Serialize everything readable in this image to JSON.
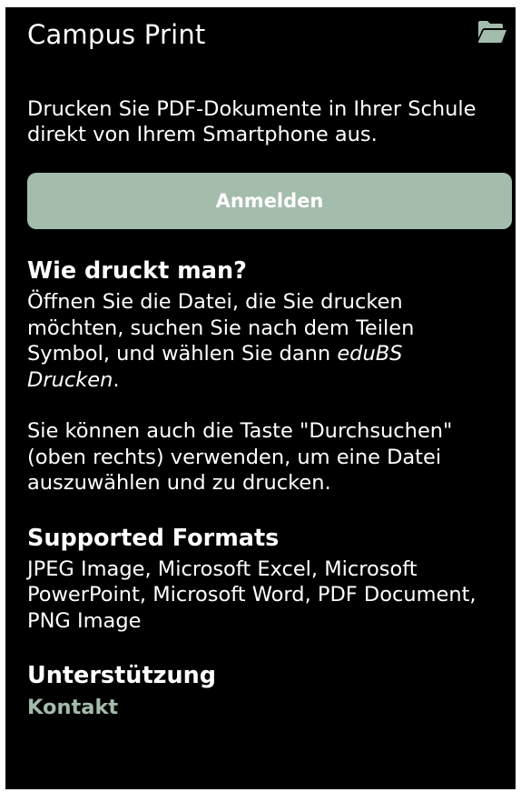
{
  "app_bar": {
    "title": "Campus Print",
    "browse_icon": "folder-open-icon"
  },
  "intro": {
    "text": "Drucken Sie PDF-Dokumente in Ihrer Schule direkt von Ihrem Smartphone aus."
  },
  "login": {
    "label": "Anmelden"
  },
  "howto": {
    "title": "Wie druckt man?",
    "para1_before": "Öffnen Sie die Datei, die Sie drucken möchten, suchen Sie nach dem Teilen Symbol, und wählen Sie dann ",
    "para1_emph": "eduBS Drucken",
    "para1_after": ".",
    "para2": "Sie können auch die Taste \"Durchsuchen\" (oben rechts) verwenden, um eine Datei auszuwählen und zu drucken."
  },
  "formats": {
    "title": "Supported Formats",
    "list": "JPEG Image, Microsoft Excel, Microsoft PowerPoint, Microsoft Word, PDF Document, PNG Image"
  },
  "support": {
    "title": "Unterstützung",
    "contact_label": "Kontakt"
  },
  "colors": {
    "background": "#000000",
    "accent": "#a3bcab",
    "text": "#ffffff"
  }
}
